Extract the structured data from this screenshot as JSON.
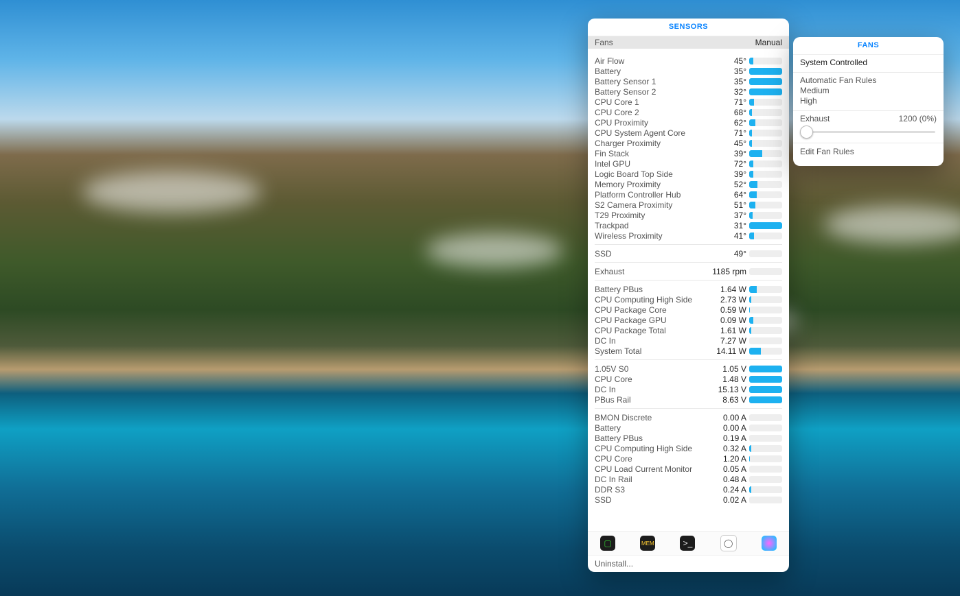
{
  "sensors_panel": {
    "title": "SENSORS",
    "subheader": {
      "left": "Fans",
      "mode": "Manual"
    },
    "temp_unit": "°",
    "temperatures": [
      {
        "name": "Air Flow",
        "value": 45,
        "pct": 12
      },
      {
        "name": "Battery",
        "value": 35,
        "pct": 100
      },
      {
        "name": "Battery Sensor 1",
        "value": 35,
        "pct": 100
      },
      {
        "name": "Battery Sensor 2",
        "value": 32,
        "pct": 100
      },
      {
        "name": "CPU Core 1",
        "value": 71,
        "pct": 14
      },
      {
        "name": "CPU Core 2",
        "value": 68,
        "pct": 8
      },
      {
        "name": "CPU Proximity",
        "value": 62,
        "pct": 18
      },
      {
        "name": "CPU System Agent Core",
        "value": 71,
        "pct": 8
      },
      {
        "name": "Charger Proximity",
        "value": 45,
        "pct": 8
      },
      {
        "name": "Fin Stack",
        "value": 39,
        "pct": 40
      },
      {
        "name": "Intel GPU",
        "value": 72,
        "pct": 12
      },
      {
        "name": "Logic Board Top Side",
        "value": 39,
        "pct": 12
      },
      {
        "name": "Memory Proximity",
        "value": 52,
        "pct": 26
      },
      {
        "name": "Platform Controller Hub",
        "value": 64,
        "pct": 22
      },
      {
        "name": "S2 Camera Proximity",
        "value": 51,
        "pct": 18
      },
      {
        "name": "T29 Proximity",
        "value": 37,
        "pct": 10
      },
      {
        "name": "Trackpad",
        "value": 31,
        "pct": 100
      },
      {
        "name": "Wireless Proximity",
        "value": 41,
        "pct": 14
      }
    ],
    "ssd": {
      "name": "SSD",
      "value": 49,
      "pct": 0
    },
    "exhaust": {
      "name": "Exhaust",
      "value": "1185 rpm",
      "pct": 0
    },
    "power_unit": "W",
    "power": [
      {
        "name": "Battery PBus",
        "value": "1.64",
        "pct": 22
      },
      {
        "name": "CPU Computing High Side",
        "value": "2.73",
        "pct": 6
      },
      {
        "name": "CPU Package Core",
        "value": "0.59",
        "pct": 3
      },
      {
        "name": "CPU Package GPU",
        "value": "0.09",
        "pct": 12
      },
      {
        "name": "CPU Package Total",
        "value": "1.61",
        "pct": 6
      },
      {
        "name": "DC In",
        "value": "7.27",
        "pct": 0
      },
      {
        "name": "System Total",
        "value": "14.11",
        "pct": 35
      }
    ],
    "voltage_unit": "V",
    "voltage": [
      {
        "name": "1.05V S0",
        "value": "1.05",
        "pct": 100
      },
      {
        "name": "CPU Core",
        "value": "1.48",
        "pct": 100
      },
      {
        "name": "DC In",
        "value": "15.13",
        "pct": 100
      },
      {
        "name": "PBus Rail",
        "value": "8.63",
        "pct": 100
      }
    ],
    "current_unit": "A",
    "current": [
      {
        "name": "BMON Discrete",
        "value": "0.00",
        "pct": 0
      },
      {
        "name": "Battery",
        "value": "0.00",
        "pct": 0
      },
      {
        "name": "Battery PBus",
        "value": "0.19",
        "pct": 0
      },
      {
        "name": "CPU Computing High Side",
        "value": "0.32",
        "pct": 7
      },
      {
        "name": "CPU Core",
        "value": "1.20",
        "pct": 3
      },
      {
        "name": "CPU Load Current Monitor",
        "value": "0.05",
        "pct": 0
      },
      {
        "name": "DC In Rail",
        "value": "0.48",
        "pct": 0
      },
      {
        "name": "DDR S3",
        "value": "0.24",
        "pct": 7
      },
      {
        "name": "SSD",
        "value": "0.02",
        "pct": 0
      }
    ],
    "footer": "Uninstall..."
  },
  "fans_panel": {
    "title": "FANS",
    "controlled_label": "System Controlled",
    "options": [
      "Automatic Fan Rules",
      "Medium",
      "High"
    ],
    "fan": {
      "name": "Exhaust",
      "rpm": 1200,
      "pct": 0,
      "display": "1200 (0%)"
    },
    "edit_label": "Edit Fan Rules"
  },
  "icons": {
    "activity": "activity-monitor-icon",
    "memory": "memory-clean-icon",
    "terminal": "terminal-icon",
    "clean": "system-cleaner-icon",
    "speed": "speedtest-icon"
  }
}
